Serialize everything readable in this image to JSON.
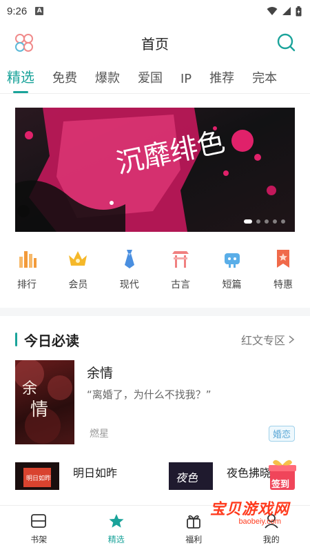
{
  "status": {
    "time": "9:26",
    "notif_letter": "A"
  },
  "header": {
    "title": "首页",
    "app_icon": "grid-rings-icon",
    "search_icon": "search-icon"
  },
  "tabs": [
    {
      "label": "精选",
      "active": true
    },
    {
      "label": "免费"
    },
    {
      "label": "爆款"
    },
    {
      "label": "爱国"
    },
    {
      "label": "IP"
    },
    {
      "label": "推荐"
    },
    {
      "label": "完本"
    }
  ],
  "banner": {
    "title_art": "沉靡绯色",
    "colors": {
      "bg": "#1a1a1a",
      "accent": "#e0216a"
    }
  },
  "categories": [
    {
      "label": "排行",
      "icon": "ranking-icon",
      "color": "#f29a3a"
    },
    {
      "label": "会员",
      "icon": "crown-icon",
      "color": "#f5b82a"
    },
    {
      "label": "现代",
      "icon": "tie-icon",
      "color": "#4a8fe0"
    },
    {
      "label": "古言",
      "icon": "gate-icon",
      "color": "#f08080"
    },
    {
      "label": "短篇",
      "icon": "robot-icon",
      "color": "#5aaee8"
    },
    {
      "label": "特惠",
      "icon": "ribbon-icon",
      "color": "#f06a4a"
    }
  ],
  "today": {
    "title": "今日必读",
    "more": "红文专区",
    "feature": {
      "title": "余情",
      "quote": "“离婚了，为什么不找我？”",
      "author": "燃星",
      "tag": "婚恋",
      "cover_text": "余情"
    },
    "minis": [
      {
        "title": "明日如昨",
        "cover_text": "明日如昨"
      },
      {
        "title": "夜色拂晓",
        "cover_text": "夜色"
      }
    ]
  },
  "checkin": {
    "label": "签到"
  },
  "bottom_nav": [
    {
      "label": "书架",
      "icon": "bookshelf-icon"
    },
    {
      "label": "精选",
      "icon": "star-icon",
      "active": true
    },
    {
      "label": "福利",
      "icon": "gift-icon"
    },
    {
      "label": "我的",
      "icon": "user-icon"
    }
  ],
  "watermark": {
    "cn": "宝贝游戏网",
    "en": "baobeiy.com"
  },
  "accent_color": "#1aa39a"
}
